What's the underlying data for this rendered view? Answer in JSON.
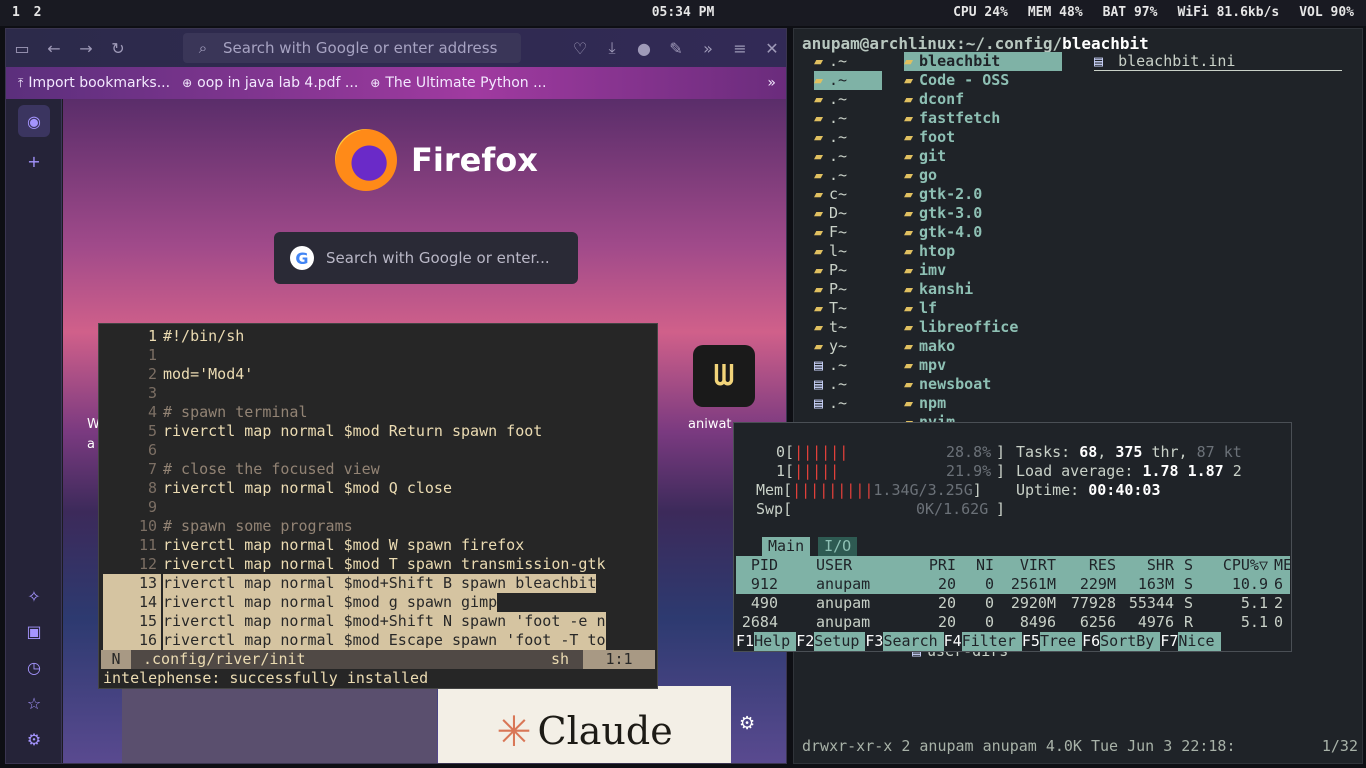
{
  "topbar": {
    "tags": [
      "1",
      "2"
    ],
    "clock": "05:34 PM",
    "stats": {
      "cpu": "CPU 24%",
      "mem": "MEM 48%",
      "bat": "BAT 97%",
      "wifi": "WiFi 81.6kb/s",
      "vol": "VOL 90%"
    }
  },
  "firefox": {
    "url_placeholder": "Search with Google or enter address",
    "bookmarks": [
      "Import bookmarks...",
      "oop in java lab 4.pdf ...",
      "The Ultimate Python ..."
    ],
    "logo_text": "Firefox",
    "search_placeholder": "Search with Google or enter...",
    "shortcut_label": "aniwat",
    "partial_label_1": "W",
    "partial_label_2": "a",
    "claude_text": "Claude",
    "icons": {
      "sidebar": "sidebar-icon",
      "back": "back-icon",
      "forward": "forward-icon",
      "reload": "reload-icon",
      "pocket": "pocket-icon",
      "downloads": "download-icon",
      "profile": "profile-icon",
      "extensions": "extensions-icon",
      "overflow": "overflow-icon",
      "menu": "menu-icon",
      "close": "close-icon"
    }
  },
  "vim": {
    "lines": [
      {
        "n": "1",
        "t": "#!/bin/sh",
        "kind": "first"
      },
      {
        "n": "1",
        "t": "",
        "kind": "rel"
      },
      {
        "n": "2",
        "t": "mod='Mod4'",
        "kind": "mod"
      },
      {
        "n": "3",
        "t": "",
        "kind": "rel"
      },
      {
        "n": "4",
        "t": "# spawn terminal",
        "kind": "comment"
      },
      {
        "n": "5",
        "t": "riverctl map normal $mod Return spawn foot",
        "kind": "code"
      },
      {
        "n": "6",
        "t": "",
        "kind": "rel"
      },
      {
        "n": "7",
        "t": "# close the focused view",
        "kind": "comment"
      },
      {
        "n": "8",
        "t": "riverctl map normal $mod Q close",
        "kind": "code"
      },
      {
        "n": "9",
        "t": "",
        "kind": "rel"
      },
      {
        "n": "10",
        "t": "# spawn some programs",
        "kind": "comment"
      },
      {
        "n": "11",
        "t": "riverctl map normal $mod W spawn firefox",
        "kind": "code"
      },
      {
        "n": "12",
        "t": "riverctl map normal $mod T spawn transmission-gtk",
        "kind": "code"
      },
      {
        "n": "13",
        "t": "riverctl map normal $mod+Shift B spawn bleachbit",
        "kind": "sel"
      },
      {
        "n": "14",
        "t": "riverctl map normal $mod g spawn gimp",
        "kind": "sel"
      },
      {
        "n": "15",
        "t": "riverctl map normal $mod+Shift N spawn 'foot -e n",
        "kind": "sel"
      },
      {
        "n": "16",
        "t": "riverctl map normal $mod Escape spawn 'foot -T to",
        "kind": "sel"
      }
    ],
    "status": {
      "mode": "N",
      "file": ".config/river/init",
      "ft": "sh",
      "pos": "1:1"
    },
    "message": "intelephense: successfully installed"
  },
  "lf": {
    "path_prefix": "anupam@archlinux:~/.config/",
    "path_dir": "bleachbit",
    "parent": [
      ".~",
      ".~",
      ".~",
      ".~",
      ".~",
      ".~",
      ".~",
      "c~",
      "D~",
      "F~",
      "l~",
      "P~",
      "P~",
      "T~",
      "t~",
      "y~",
      ".~",
      ".~",
      ".~"
    ],
    "current": [
      "bleachbit",
      "Code - OSS",
      "dconf",
      "fastfetch",
      "foot",
      "git",
      "go",
      "gtk-2.0",
      "gtk-3.0",
      "gtk-4.0",
      "htop",
      "imv",
      "kanshi",
      "lf",
      "libreoffice",
      "mako",
      "mpv",
      "newsboat",
      "npm",
      "nvim"
    ],
    "preview": "bleachbit.ini",
    "below_htop": "user-dirs",
    "info": "drwxr-xr-x 2 anupam anupam 4.0K Tue Jun  3 22:18:",
    "position": "1/32"
  },
  "htop": {
    "cpu0": {
      "label": "0",
      "bar": "||||||",
      "pct": "28.8%"
    },
    "cpu1": {
      "label": "1",
      "bar": "|||||",
      "pct": "21.9%"
    },
    "mem": {
      "label": "Mem",
      "bar": "|||||||||",
      "val": "1.34G/3.25G"
    },
    "swp": {
      "label": "Swp",
      "val": "0K/1.62G"
    },
    "tasks": {
      "label": "Tasks:",
      "tasks": "68",
      "sep": ",",
      "thr": "375",
      "thr_label": "thr,",
      "kt": "87 kt"
    },
    "load": {
      "label": "Load average:",
      "l1": "1.78",
      "l5": "1.87",
      "l15": "2"
    },
    "uptime": {
      "label": "Uptime:",
      "val": "00:40:03"
    },
    "tabs": [
      "Main",
      "I/O"
    ],
    "headers": [
      "PID",
      "USER",
      "PRI",
      "NI",
      "VIRT",
      "RES",
      "SHR",
      "S",
      "CPU%▽",
      "ME"
    ],
    "rows": [
      [
        "912",
        "anupam",
        "20",
        "0",
        "2561M",
        "229M",
        "163M",
        "S",
        "10.9",
        "6"
      ],
      [
        "490",
        "anupam",
        "20",
        "0",
        "2920M",
        "77928",
        "55344",
        "S",
        "5.1",
        "2"
      ],
      [
        "2684",
        "anupam",
        "20",
        "0",
        "8496",
        "6256",
        "4976",
        "R",
        "5.1",
        "0"
      ]
    ],
    "fkeys": [
      [
        "F1",
        "Help"
      ],
      [
        "F2",
        "Setup"
      ],
      [
        "F3",
        "Search"
      ],
      [
        "F4",
        "Filter"
      ],
      [
        "F5",
        "Tree"
      ],
      [
        "F6",
        "SortBy"
      ],
      [
        "F7",
        "Nice"
      ]
    ]
  }
}
